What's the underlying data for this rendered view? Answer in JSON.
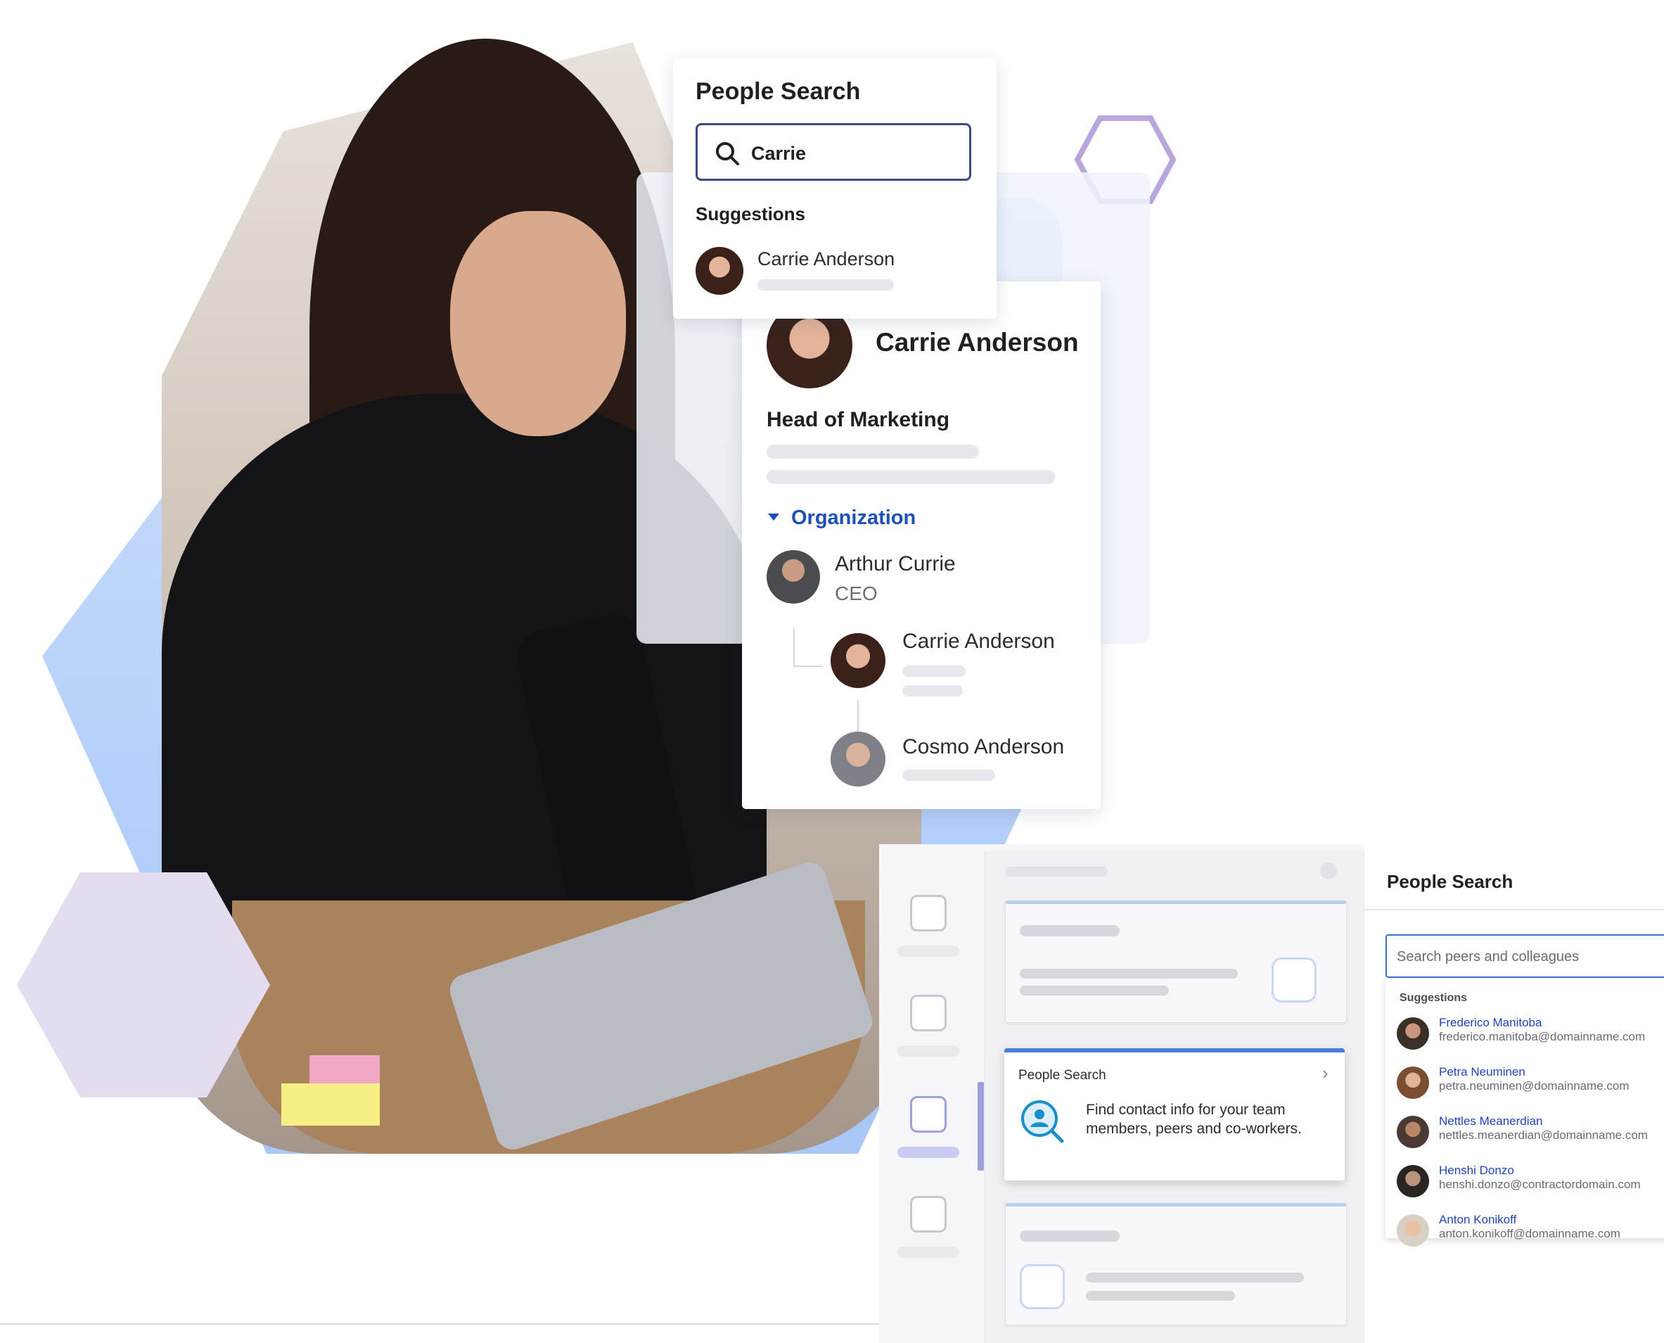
{
  "profile_search": {
    "title": "People Search",
    "search_value": "Carrie",
    "suggestions_label": "Suggestions",
    "suggestion_name": "Carrie Anderson"
  },
  "profile": {
    "name": "Carrie Anderson",
    "job_title": "Head of Marketing",
    "organization_label": "Organization",
    "org": [
      {
        "name": "Arthur Currie",
        "role": "CEO"
      },
      {
        "name": "Carrie Anderson"
      },
      {
        "name": "Cosmo Anderson"
      }
    ]
  },
  "app": {
    "popover": {
      "title": "People Search",
      "description": "Find contact info for your team members, peers and co-workers."
    },
    "people_search": {
      "title": "People Search",
      "placeholder": "Search peers and colleagues",
      "suggestions_label": "Suggestions",
      "people": [
        {
          "name": "Frederico Manitoba",
          "email": "frederico.manitoba@domainname.com"
        },
        {
          "name": "Petra Neuminen",
          "email": "petra.neuminen@domainname.com"
        },
        {
          "name": "Nettles Meanerdian",
          "email": "nettles.meanerdian@domainname.com"
        },
        {
          "name": "Henshi Donzo",
          "email": "henshi.donzo@contractordomain.com"
        },
        {
          "name": "Anton Konikoff",
          "email": "anton.konikoff@domainname.com"
        }
      ]
    }
  },
  "colors": {
    "accent_blue": "#1d4fb8",
    "link_blue": "#2145b8",
    "hex_outline": "#b9a6dd",
    "hero_blue": "#b5d0fa"
  }
}
